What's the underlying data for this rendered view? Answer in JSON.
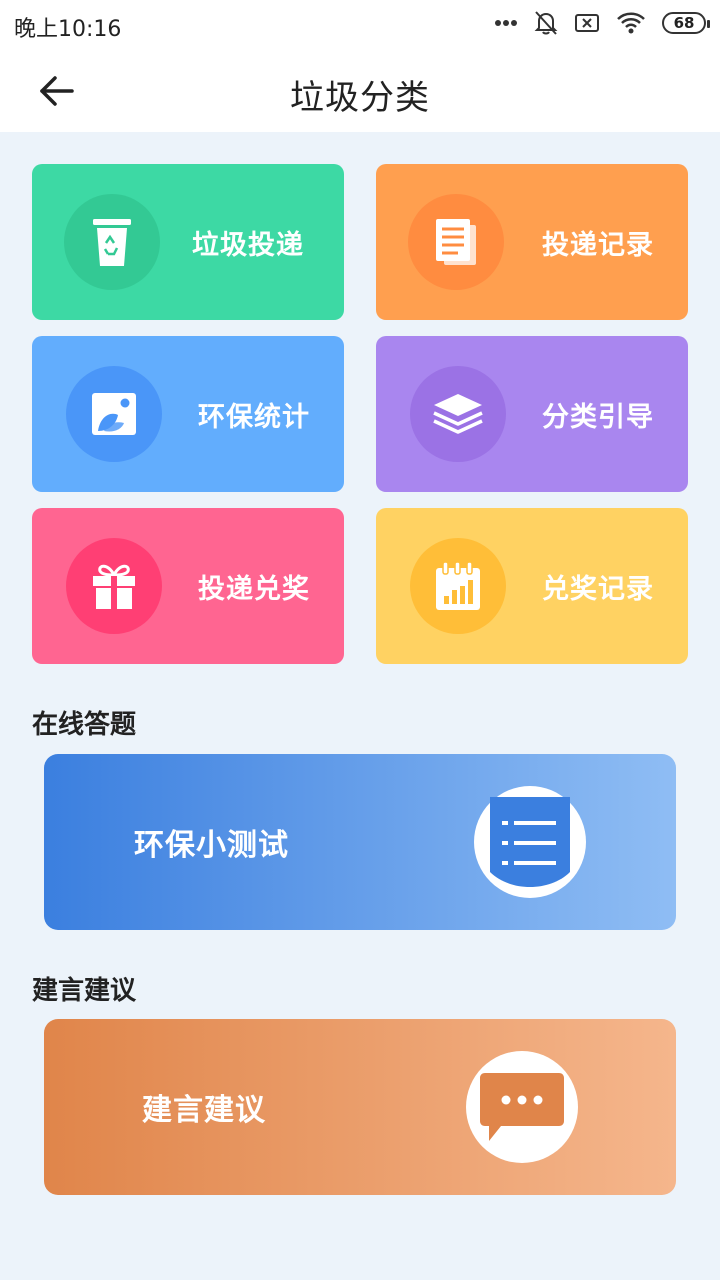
{
  "status_bar": {
    "time": "晚上10:16",
    "battery": "68",
    "icons": [
      "more-dots-icon",
      "bell-off-icon",
      "sim-off-icon",
      "wifi-icon",
      "battery-icon"
    ]
  },
  "header": {
    "title": "垃圾分类",
    "back_icon": "arrow-left-icon"
  },
  "grid": {
    "items": [
      {
        "label": "垃圾投递",
        "icon": "recycle-bin-icon",
        "color": "#3dd9a4",
        "circle": "#33c994"
      },
      {
        "label": "投递记录",
        "icon": "documents-icon",
        "color": "#ff9f4f",
        "circle": "#ff8c40"
      },
      {
        "label": "环保统计",
        "icon": "leaf-picture-icon",
        "color": "#62adfd",
        "circle": "#4a96f8"
      },
      {
        "label": "分类引导",
        "icon": "layers-icon",
        "color": "#a986ef",
        "circle": "#9b72e5"
      },
      {
        "label": "投递兑奖",
        "icon": "gift-icon",
        "color": "#ff6591",
        "circle": "#ff3f74"
      },
      {
        "label": "兑奖记录",
        "icon": "calendar-chart-icon",
        "color": "#ffd262",
        "circle": "#ffbe38"
      }
    ]
  },
  "quiz": {
    "section_title": "在线答题",
    "banner_label": "环保小测试",
    "icon": "list-document-icon",
    "color_start": "#3b7fdf",
    "color_end": "#8fbdf4"
  },
  "advice": {
    "section_title": "建言建议",
    "banner_label": "建言建议",
    "icon": "chat-bubble-icon",
    "color_start": "#e0854a",
    "color_end": "#f5b68c"
  }
}
